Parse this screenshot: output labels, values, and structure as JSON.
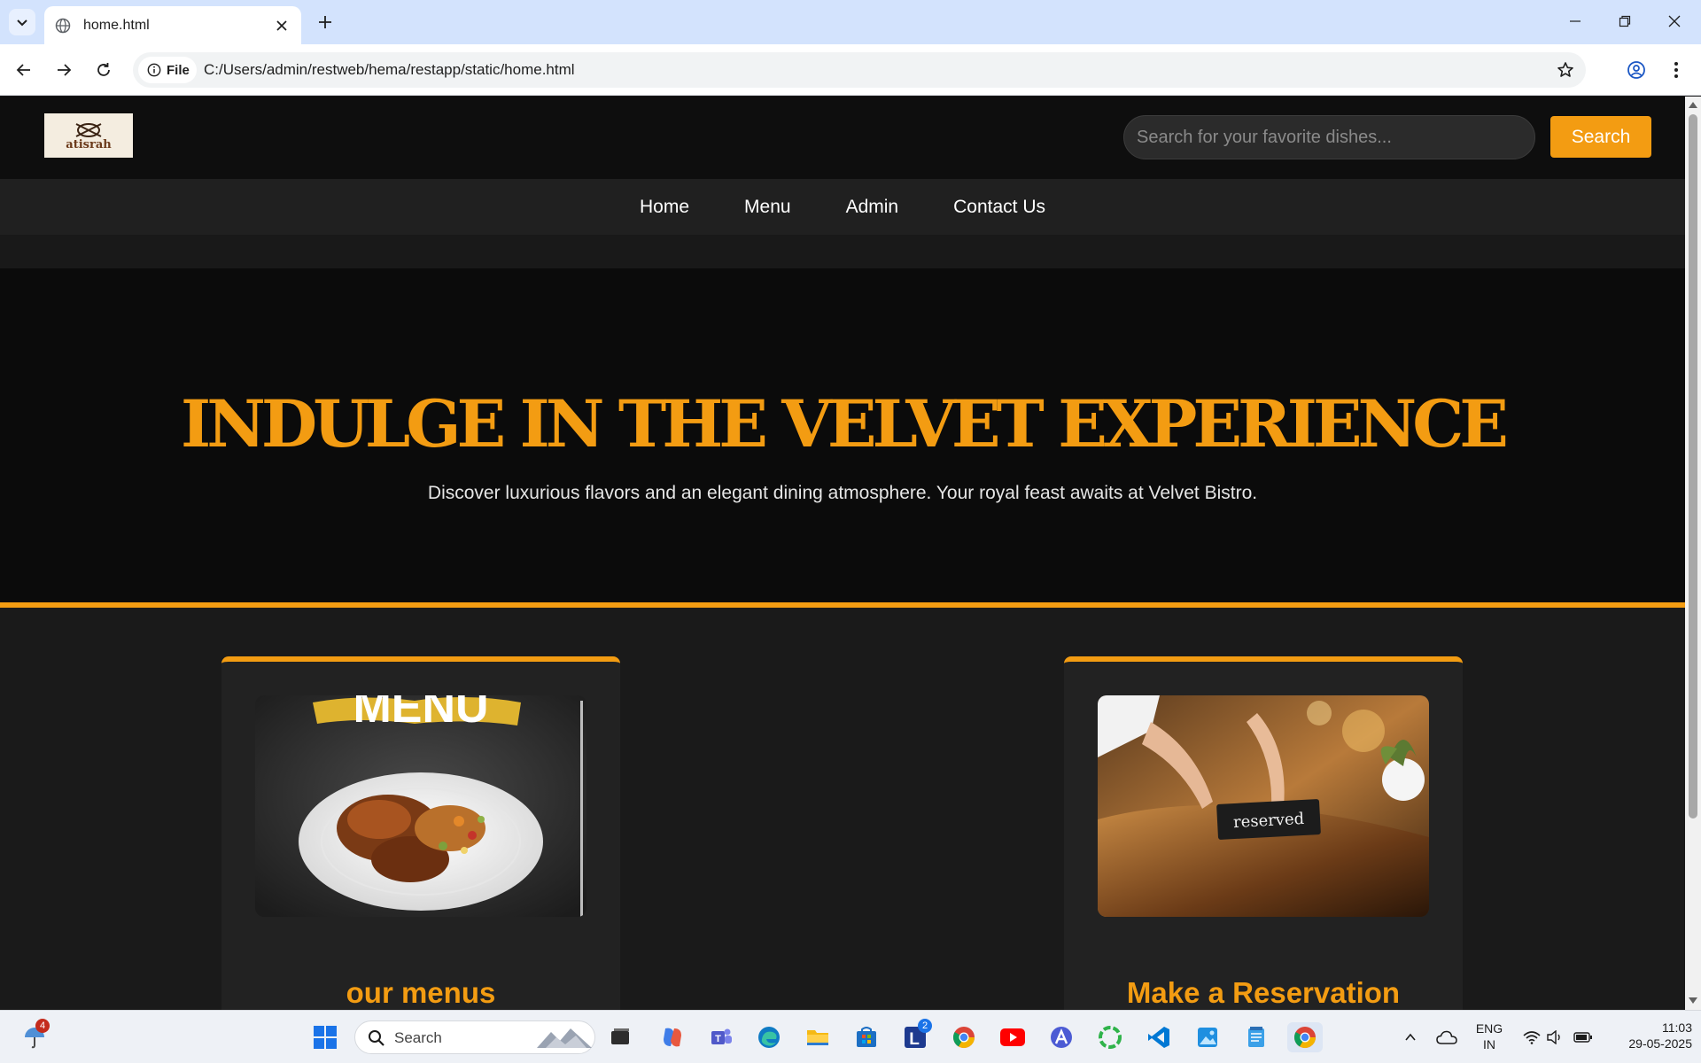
{
  "browser": {
    "tab_title": "home.html",
    "address_chip": "File",
    "url": "C:/Users/admin/restweb/hema/restapp/static/home.html"
  },
  "site": {
    "logo_text": "atisrah",
    "search": {
      "placeholder": "Search for your favorite dishes...",
      "button_label": "Search"
    },
    "nav": [
      "Home",
      "Menu",
      "Admin",
      "Contact Us"
    ],
    "hero": {
      "title": "INDULGE IN THE VELVET EXPERIENCE",
      "subtitle": "Discover luxurious flavors and an elegant dining atmosphere. Your royal feast awaits at Velvet Bistro."
    },
    "cards": [
      {
        "title": "our menus",
        "image_label": "MENU"
      },
      {
        "title": "Make a Reservation",
        "image_label": "reserved"
      }
    ],
    "accent_color": "#f39c12"
  },
  "taskbar": {
    "search_label": "Search",
    "weather_badge": "4",
    "teams_badge": "2",
    "lang_line1": "ENG",
    "lang_line2": "IN",
    "time": "11:03",
    "date": "29-05-2025"
  }
}
